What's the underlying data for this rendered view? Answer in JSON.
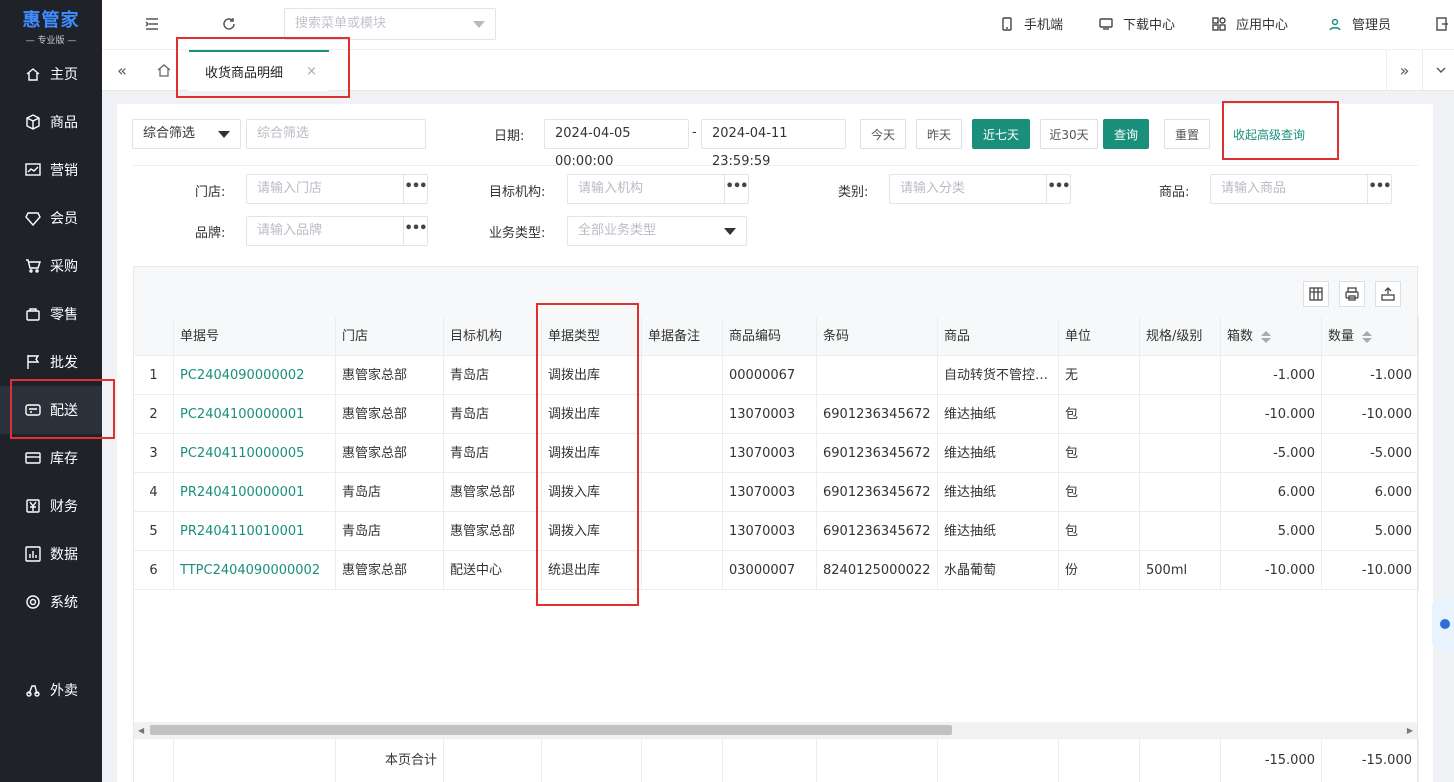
{
  "app": {
    "logo_title": "惠管家",
    "logo_sub": "— 专业版 —"
  },
  "sidebar": {
    "items": [
      {
        "label": "主页",
        "icon": "home-icon"
      },
      {
        "label": "商品",
        "icon": "box-icon"
      },
      {
        "label": "营销",
        "icon": "chart-icon"
      },
      {
        "label": "会员",
        "icon": "diamond-icon"
      },
      {
        "label": "采购",
        "icon": "cart-icon"
      },
      {
        "label": "零售",
        "icon": "bag-icon"
      },
      {
        "label": "批发",
        "icon": "flag-icon"
      },
      {
        "label": "配送",
        "icon": "truck-icon",
        "active": true
      },
      {
        "label": "库存",
        "icon": "inventory-icon"
      },
      {
        "label": "财务",
        "icon": "yen-icon"
      },
      {
        "label": "数据",
        "icon": "data-icon"
      },
      {
        "label": "系统",
        "icon": "settings-icon"
      },
      {
        "label": "外卖",
        "icon": "delivery-icon"
      }
    ]
  },
  "topbar": {
    "search_placeholder": "搜索菜单或模块",
    "mobile": "手机端",
    "download": "下载中心",
    "apps": "应用中心",
    "user": "管理员"
  },
  "tabs": {
    "active": "收货商品明细",
    "close": "×"
  },
  "filters": {
    "combo_select": "综合筛选",
    "combo_placeholder": "综合筛选",
    "date_label": "日期:",
    "date_start": "2024-04-05 00:00:00",
    "date_sep": "-",
    "date_end": "2024-04-11 23:59:59",
    "btn_today": "今天",
    "btn_yesterday": "昨天",
    "btn_7days": "近七天",
    "btn_30days": "近30天",
    "btn_query": "查询",
    "btn_reset": "重置",
    "collapse_advanced": "收起高级查询",
    "store_label": "门店:",
    "store_placeholder": "请输入门店",
    "target_label": "目标机构:",
    "target_placeholder": "请输入机构",
    "category_label": "类别:",
    "category_placeholder": "请输入分类",
    "product_label": "商品:",
    "product_placeholder": "请输入商品",
    "brand_label": "品牌:",
    "brand_placeholder": "请输入品牌",
    "biz_label": "业务类型:",
    "biz_placeholder": "全部业务类型",
    "dots": "•••"
  },
  "table": {
    "headers": [
      "单据号",
      "门店",
      "目标机构",
      "单据类型",
      "单据备注",
      "商品编码",
      "条码",
      "商品",
      "单位",
      "规格/级别",
      "箱数",
      "数量"
    ],
    "rows": [
      {
        "idx": "1",
        "doc": "PC2404090000002",
        "store": "惠管家总部",
        "target": "青岛店",
        "type": "调拨出库",
        "note": "",
        "code": "00000067",
        "barcode": "",
        "product": "自动转货不管控库存",
        "unit": "无",
        "spec": "",
        "boxes": "-1.000",
        "qty": "-1.000"
      },
      {
        "idx": "2",
        "doc": "PC2404100000001",
        "store": "惠管家总部",
        "target": "青岛店",
        "type": "调拨出库",
        "note": "",
        "code": "13070003",
        "barcode": "6901236345672",
        "product": "维达抽纸",
        "unit": "包",
        "spec": "",
        "boxes": "-10.000",
        "qty": "-10.000"
      },
      {
        "idx": "3",
        "doc": "PC2404110000005",
        "store": "惠管家总部",
        "target": "青岛店",
        "type": "调拨出库",
        "note": "",
        "code": "13070003",
        "barcode": "6901236345672",
        "product": "维达抽纸",
        "unit": "包",
        "spec": "",
        "boxes": "-5.000",
        "qty": "-5.000"
      },
      {
        "idx": "4",
        "doc": "PR2404100000001",
        "store": "青岛店",
        "target": "惠管家总部",
        "type": "调拨入库",
        "note": "",
        "code": "13070003",
        "barcode": "6901236345672",
        "product": "维达抽纸",
        "unit": "包",
        "spec": "",
        "boxes": "6.000",
        "qty": "6.000"
      },
      {
        "idx": "5",
        "doc": "PR2404110010001",
        "store": "青岛店",
        "target": "惠管家总部",
        "type": "调拨入库",
        "note": "",
        "code": "13070003",
        "barcode": "6901236345672",
        "product": "维达抽纸",
        "unit": "包",
        "spec": "",
        "boxes": "5.000",
        "qty": "5.000"
      },
      {
        "idx": "6",
        "doc": "TTPC2404090000002",
        "store": "惠管家总部",
        "target": "配送中心",
        "type": "统退出库",
        "note": "",
        "code": "03000007",
        "barcode": "8240125000022",
        "product": "水晶葡萄",
        "unit": "份",
        "spec": "500ml",
        "boxes": "-10.000",
        "qty": "-10.000"
      }
    ],
    "footer": {
      "label": "本页合计",
      "boxes": "-15.000",
      "qty": "-15.000"
    }
  }
}
